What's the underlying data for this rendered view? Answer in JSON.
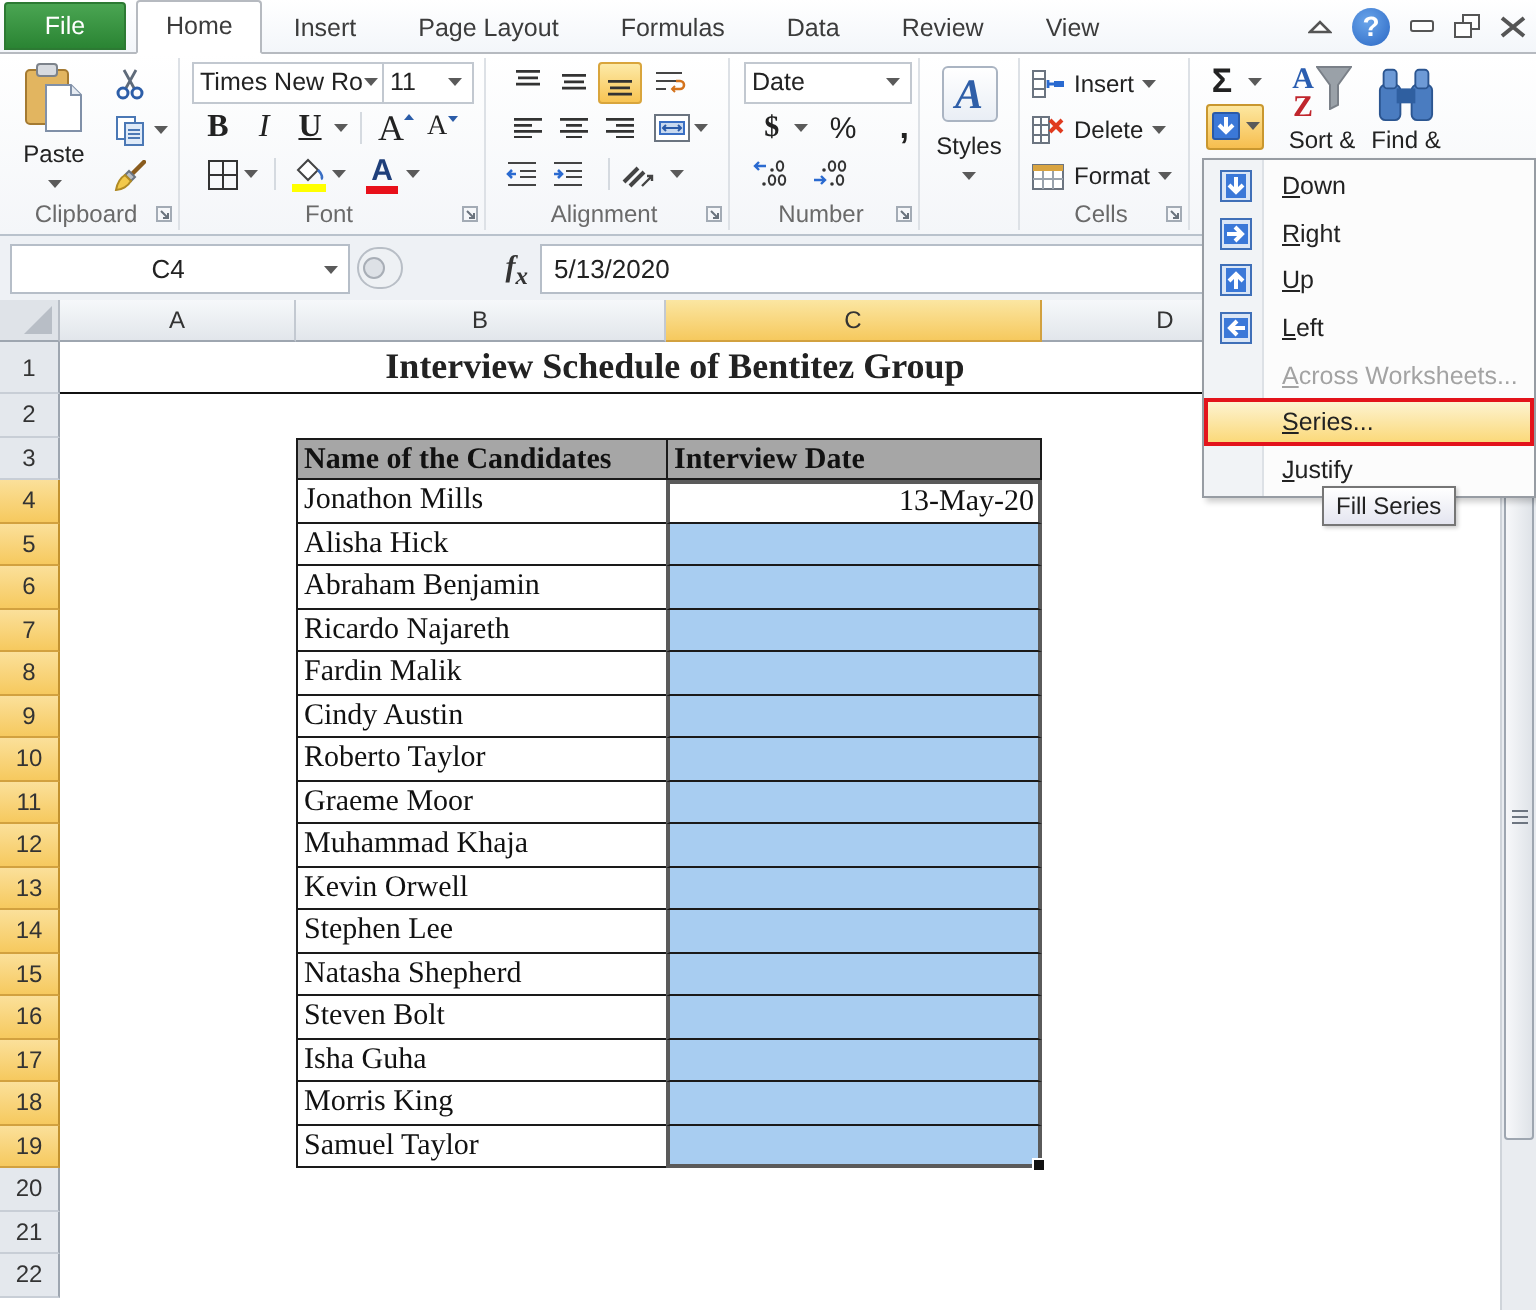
{
  "tabs": [
    {
      "label": "File",
      "kind": "file",
      "selected": false
    },
    {
      "label": "Home",
      "kind": "tab",
      "selected": true
    },
    {
      "label": "Insert",
      "kind": "tab",
      "selected": false
    },
    {
      "label": "Page Layout",
      "kind": "tab",
      "selected": false
    },
    {
      "label": "Formulas",
      "kind": "tab",
      "selected": false
    },
    {
      "label": "Data",
      "kind": "tab",
      "selected": false
    },
    {
      "label": "Review",
      "kind": "tab",
      "selected": false
    },
    {
      "label": "View",
      "kind": "tab",
      "selected": false
    }
  ],
  "window_controls": {
    "help": "?"
  },
  "ribbon": {
    "clipboard": {
      "paste": "Paste",
      "label": "Clipboard"
    },
    "font": {
      "name": "Times New Ro",
      "size": "11",
      "styles": [
        {
          "label": "B",
          "kind": "bold"
        },
        {
          "label": "I",
          "kind": "italic"
        },
        {
          "label": "U",
          "kind": "underline"
        }
      ],
      "grow": "A",
      "shrink": "A",
      "font_color_glyph": "A",
      "label": "Font"
    },
    "alignment": {
      "vertical": [
        {
          "kind": "top",
          "selected": false
        },
        {
          "kind": "middle",
          "selected": false
        },
        {
          "kind": "bottom",
          "selected": true
        }
      ],
      "horizontal": [
        {
          "kind": "left",
          "selected": false
        },
        {
          "kind": "center",
          "selected": false
        },
        {
          "kind": "right",
          "selected": false
        }
      ],
      "label": "Alignment"
    },
    "number": {
      "format": "Date",
      "currency": "$",
      "percent": "%",
      "comma": ",",
      "label": "Number"
    },
    "styles": {
      "glyph": "A",
      "label": "Styles"
    },
    "cells": {
      "buttons": [
        {
          "label": "Insert",
          "kind": "insert"
        },
        {
          "label": "Delete",
          "kind": "delete"
        },
        {
          "label": "Format",
          "kind": "format"
        }
      ],
      "label": "Cells"
    },
    "editing": {
      "sum": "Σ",
      "fill_selected": true,
      "sort_glyphs": [
        "A",
        "Z"
      ],
      "sort": "Sort &",
      "find": "Find &"
    }
  },
  "formula_bar": {
    "name_box": "C4",
    "fx": "f$_{x}$",
    "formula": "5/13/2020"
  },
  "sheet": {
    "columns": [
      {
        "label": "A",
        "selected": false
      },
      {
        "label": "B",
        "selected": false
      },
      {
        "label": "C",
        "selected": true
      },
      {
        "label": "D",
        "selected": false
      }
    ],
    "rows": [
      {
        "number": "1",
        "kind": "title",
        "text": "Interview Schedule of Bentitez Group",
        "selected": false
      },
      {
        "number": "2",
        "kind": "blank",
        "selected": false
      },
      {
        "number": "3",
        "kind": "header",
        "name": "Name of the Candidates",
        "date": "Interview Date",
        "selected": false
      },
      {
        "number": "4",
        "kind": "data",
        "name": "Jonathon Mills",
        "date": "13-May-20",
        "selected": true,
        "active": true
      },
      {
        "number": "5",
        "kind": "data",
        "name": "Alisha Hick",
        "selected": true,
        "active": false
      },
      {
        "number": "6",
        "kind": "data",
        "name": "Abraham Benjamin",
        "selected": true,
        "active": false
      },
      {
        "number": "7",
        "kind": "data",
        "name": "Ricardo Najareth",
        "selected": true,
        "active": false
      },
      {
        "number": "8",
        "kind": "data",
        "name": "Fardin Malik",
        "selected": true,
        "active": false
      },
      {
        "number": "9",
        "kind": "data",
        "name": "Cindy Austin",
        "selected": true,
        "active": false
      },
      {
        "number": "10",
        "kind": "data",
        "name": "Roberto Taylor",
        "selected": true,
        "active": false
      },
      {
        "number": "11",
        "kind": "data",
        "name": "Graeme Moor",
        "selected": true,
        "active": false
      },
      {
        "number": "12",
        "kind": "data",
        "name": "Muhammad Khaja",
        "selected": true,
        "active": false
      },
      {
        "number": "13",
        "kind": "data",
        "name": "Kevin Orwell",
        "selected": true,
        "active": false
      },
      {
        "number": "14",
        "kind": "data",
        "name": "Stephen Lee",
        "selected": true,
        "active": false
      },
      {
        "number": "15",
        "kind": "data",
        "name": "Natasha Shepherd",
        "selected": true,
        "active": false
      },
      {
        "number": "16",
        "kind": "data",
        "name": "Steven Bolt",
        "selected": true,
        "active": false
      },
      {
        "number": "17",
        "kind": "data",
        "name": "Isha Guha",
        "selected": true,
        "active": false
      },
      {
        "number": "18",
        "kind": "data",
        "name": "Morris King",
        "selected": true,
        "active": false
      },
      {
        "number": "19",
        "kind": "data",
        "name": "Samuel Taylor",
        "selected": true,
        "active": false
      },
      {
        "number": "20",
        "kind": "blank",
        "selected": false
      },
      {
        "number": "21",
        "kind": "blank",
        "selected": false
      },
      {
        "number": "22",
        "kind": "blank",
        "selected": false
      }
    ]
  },
  "fill_menu": {
    "items": [
      {
        "label": "Down",
        "kind": "down",
        "disabled": false,
        "selected": false,
        "outlined": false
      },
      {
        "label": "Right",
        "kind": "right",
        "disabled": false,
        "selected": false,
        "outlined": false
      },
      {
        "label": "Up",
        "kind": "up",
        "disabled": false,
        "selected": false,
        "outlined": false
      },
      {
        "label": "Left",
        "kind": "left",
        "disabled": false,
        "selected": false,
        "outlined": false
      },
      {
        "label": "Across Worksheets...",
        "kind": "plain",
        "disabled": true,
        "selected": false,
        "outlined": false
      },
      {
        "label": "Series...",
        "kind": "plain",
        "disabled": false,
        "selected": true,
        "outlined": true
      },
      {
        "label": "Justify",
        "kind": "plain",
        "disabled": false,
        "selected": false,
        "outlined": false
      }
    ]
  },
  "tooltip": "Fill Series"
}
